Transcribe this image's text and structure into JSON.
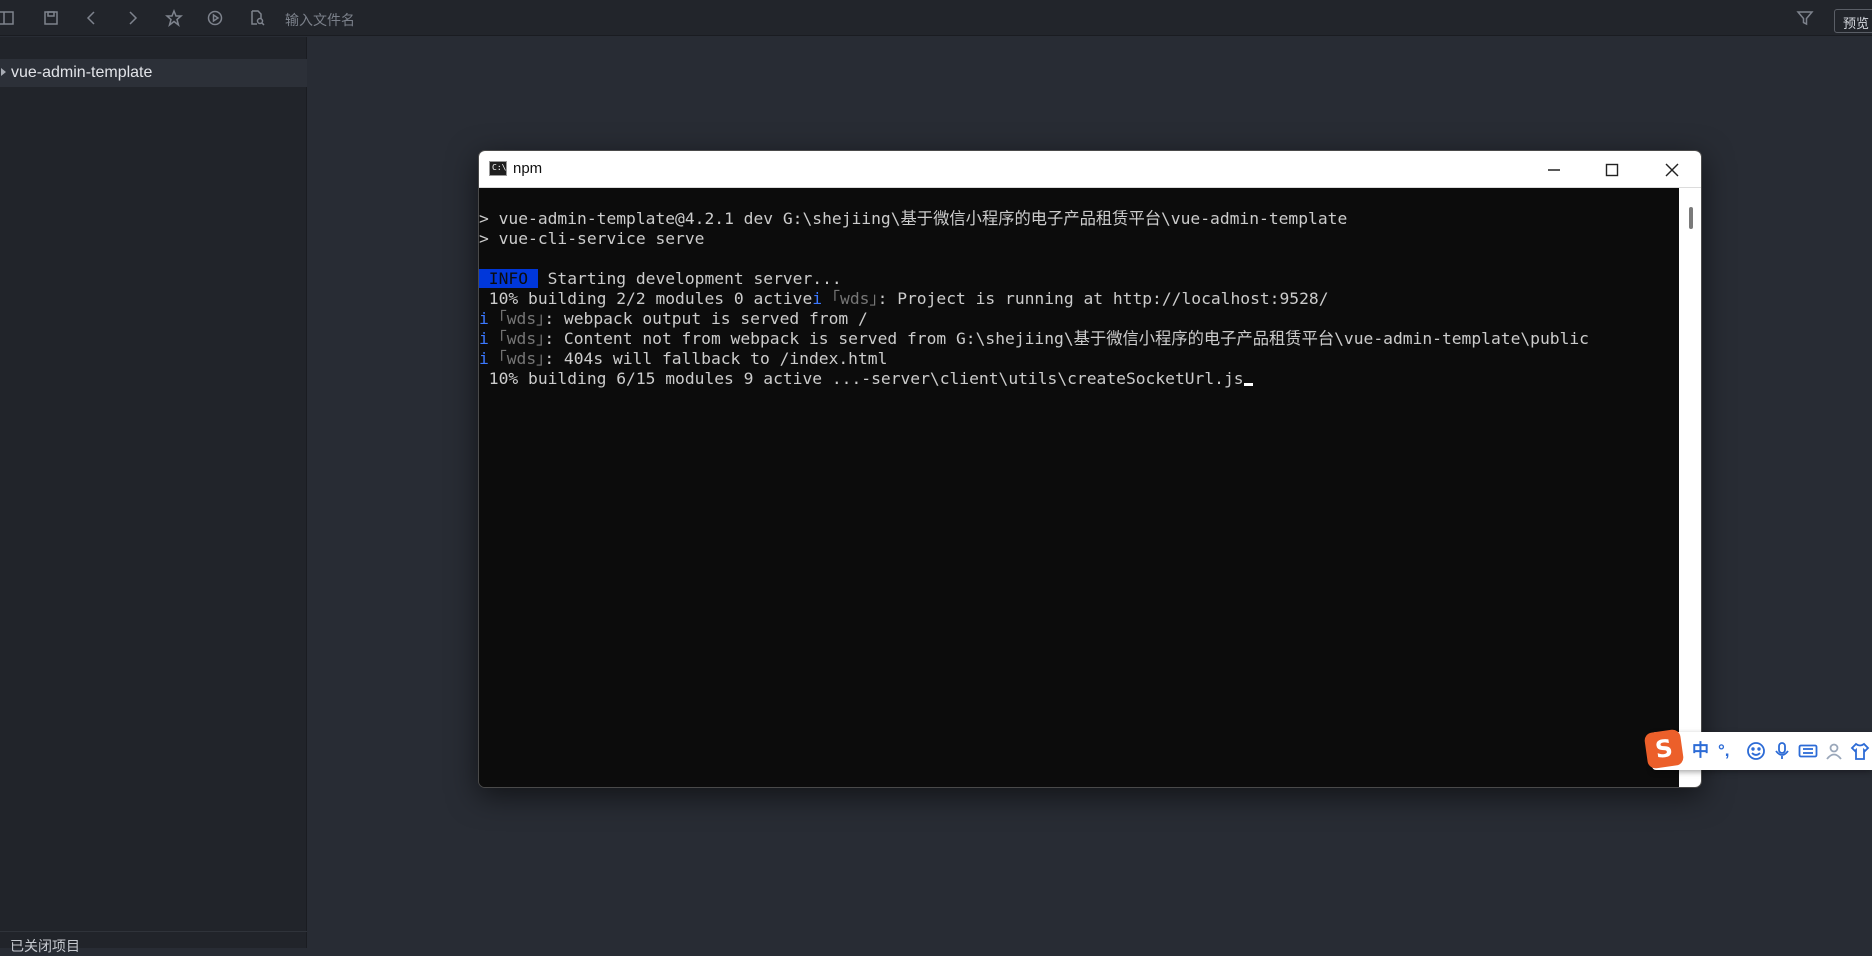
{
  "toolbar": {
    "search_placeholder": "输入文件名",
    "preview_label": "预览",
    "icons": [
      "layout-icon",
      "save-icon",
      "back-icon",
      "forward-icon",
      "star-icon",
      "run-icon",
      "file-search-icon",
      "filter-icon"
    ]
  },
  "sidebar": {
    "project_name": "vue-admin-template",
    "footer_label": "已关闭项目"
  },
  "terminal": {
    "title": "npm",
    "icon_text": "C:\\",
    "lines": {
      "l1_prompt": ">",
      "l1_text": " vue-admin-template@4.2.1 dev G:\\shejiing\\基于微信小程序的电子产品租赁平台\\vue-admin-template",
      "l2_prompt": ">",
      "l2_text": " vue-cli-service serve",
      "l4_badge": " INFO ",
      "l4_text": " Starting development server...",
      "l5_text_a": " 10% building 2/2 modules 0 active",
      "l5_i": "i",
      "l5_wds": " ｢wds｣",
      "l5_text_b": ": Project is running at http://localhost:9528/",
      "l6_i": "i",
      "l6_wds": " ｢wds｣",
      "l6_text": ": webpack output is served from /",
      "l7_i": "i",
      "l7_wds": " ｢wds｣",
      "l7_text": ": Content not from webpack is served from G:\\shejiing\\基于微信小程序的电子产品租赁平台\\vue-admin-template\\public",
      "l8_i": "i",
      "l8_wds": " ｢wds｣",
      "l8_text": ": 404s will fallback to /index.html",
      "l9_text": " 10% building 6/15 modules 9 active ...-server\\client\\utils\\createSocketUrl.js"
    }
  },
  "ime": {
    "logo": "S",
    "mode": "中",
    "punct": "°,",
    "icons": [
      "emoji-icon",
      "mic-icon",
      "keyboard-icon",
      "user-icon",
      "shirt-icon"
    ]
  }
}
